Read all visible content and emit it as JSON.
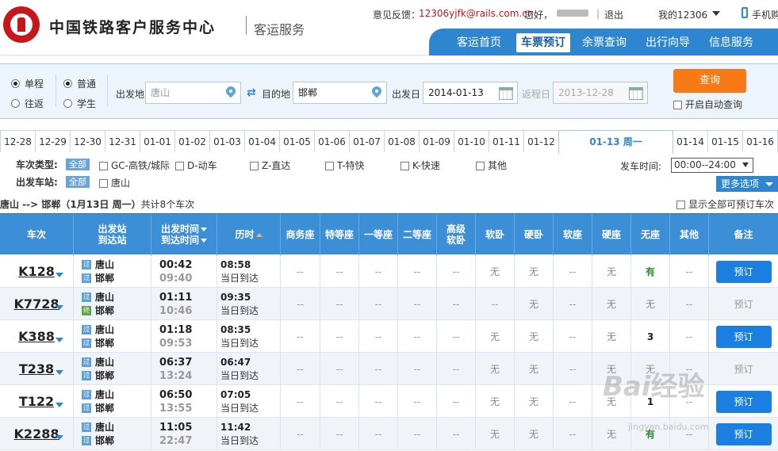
{
  "header": {
    "logo_icon": "railway-logo-icon",
    "title": "中国铁路客户服务中心",
    "subtitle": "客运服务",
    "feedback_label": "意见反馈：",
    "feedback_email": "12306yjfk@rails.com.cn",
    "greeting": "您好，",
    "logout": "退出",
    "my12306": "我的12306",
    "mobile": "手机购"
  },
  "nav": {
    "tabs": [
      "客运首页",
      "车票预订",
      "余票查询",
      "出行向导",
      "信息服务"
    ],
    "active": "车票预订"
  },
  "query": {
    "trip_single": "单程",
    "trip_round": "往返",
    "type_normal": "普通",
    "type_student": "学生",
    "from_label": "出发地",
    "from_value": "唐山",
    "to_label": "目的地",
    "to_value": "邯郸",
    "depart_label": "出发日",
    "depart_value": "2014-01-13",
    "return_label": "返程日",
    "return_value": "2013-12-28",
    "search_button": "查询",
    "auto_query": "开启自动查询"
  },
  "dates": [
    "12-28",
    "12-29",
    "12-30",
    "12-31",
    "01-01",
    "01-02",
    "01-03",
    "01-04",
    "01-05",
    "01-06",
    "01-07",
    "01-08",
    "01-09",
    "01-10",
    "01-11",
    "01-12",
    "01-13 周一",
    "01-14",
    "01-15",
    "01-16"
  ],
  "selected_date": "01-13 周一",
  "filters": {
    "train_type_label": "车次类型:",
    "all": "全部",
    "types": [
      "GC-高铁/城际",
      "D-动车",
      "Z-直达",
      "T-特快",
      "K-快速",
      "其他"
    ],
    "station_label": "出发车站:",
    "stations": [
      "唐山"
    ],
    "time_label": "发车时间:",
    "time_value": "00:00--24:00",
    "more": "更多选项"
  },
  "summary": {
    "route": "唐山 --> 邯郸（1月13日 周一）",
    "count": "共计8个车次",
    "show_all": "显示全部可预订车次"
  },
  "table": {
    "headers": {
      "train": "车次",
      "station_dep": "出发站",
      "station_arr": "到达站",
      "time_dep": "出发时间",
      "time_arr": "到达时间",
      "duration": "历时",
      "business": "商务座",
      "special": "特等座",
      "first": "一等座",
      "second": "二等座",
      "senior_1": "高级",
      "senior_2": "软卧",
      "soft_sleeper": "软卧",
      "hard_sleeper": "硬卧",
      "soft_seat": "软座",
      "hard_seat": "硬座",
      "no_seat": "无座",
      "other": "其他",
      "remark": "备注"
    },
    "rows": [
      {
        "train": "K128",
        "from": "唐山",
        "to": "邯郸",
        "from_tag": "过",
        "to_tag": "过",
        "dep": "00:42",
        "arr": "09:40",
        "dur": "08:58",
        "day": "当日到达",
        "seats": [
          "--",
          "--",
          "--",
          "--",
          "--",
          "无",
          "无",
          "--",
          "无",
          "有",
          "--"
        ],
        "book": "预订",
        "bookable": true
      },
      {
        "train": "K7728",
        "from": "唐山",
        "to": "邯郸",
        "from_tag": "过",
        "to_tag": "终",
        "dep": "01:11",
        "arr": "10:46",
        "dur": "09:35",
        "day": "当日到达",
        "seats": [
          "--",
          "--",
          "--",
          "--",
          "--",
          "--",
          "无",
          "--",
          "无",
          "无",
          "--"
        ],
        "book": "预订",
        "bookable": false
      },
      {
        "train": "K388",
        "from": "唐山",
        "to": "邯郸",
        "from_tag": "过",
        "to_tag": "过",
        "dep": "01:18",
        "arr": "09:53",
        "dur": "08:35",
        "day": "当日到达",
        "seats": [
          "--",
          "--",
          "--",
          "--",
          "--",
          "无",
          "无",
          "--",
          "无",
          "3",
          "--"
        ],
        "book": "预订",
        "bookable": true
      },
      {
        "train": "T238",
        "from": "唐山",
        "to": "邯郸",
        "from_tag": "过",
        "to_tag": "过",
        "dep": "06:37",
        "arr": "13:24",
        "dur": "06:47",
        "day": "当日到达",
        "seats": [
          "--",
          "--",
          "--",
          "--",
          "--",
          "无",
          "无",
          "--",
          "无",
          "无",
          "--"
        ],
        "book": "预订",
        "bookable": false
      },
      {
        "train": "T122",
        "from": "唐山",
        "to": "邯郸",
        "from_tag": "过",
        "to_tag": "过",
        "dep": "06:50",
        "arr": "13:55",
        "dur": "07:05",
        "day": "当日到达",
        "seats": [
          "--",
          "--",
          "--",
          "--",
          "--",
          "无",
          "无",
          "--",
          "无",
          "1",
          "--"
        ],
        "book": "预订",
        "bookable": true
      },
      {
        "train": "K2288",
        "from": "唐山",
        "to": "邯郸",
        "from_tag": "过",
        "to_tag": "过",
        "dep": "11:05",
        "arr": "22:47",
        "dur": "11:42",
        "day": "当日到达",
        "seats": [
          "--",
          "--",
          "--",
          "--",
          "--",
          "无",
          "无",
          "--",
          "无",
          "有",
          "--"
        ],
        "book": "预订",
        "bookable": true
      }
    ]
  },
  "watermark": {
    "text": "Bai 经验",
    "url": "jingyan.baidu.com"
  }
}
